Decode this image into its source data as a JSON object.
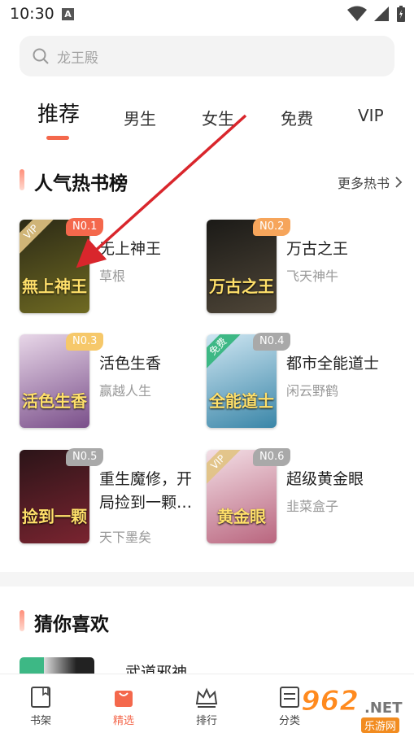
{
  "status_bar": {
    "time": "10:30",
    "notif_letter": "A"
  },
  "search": {
    "placeholder": "龙王殿"
  },
  "tabs": [
    {
      "label": "推荐",
      "active": true
    },
    {
      "label": "男生"
    },
    {
      "label": "女生"
    },
    {
      "label": "免费"
    },
    {
      "label": "VIP"
    }
  ],
  "hot_section": {
    "title": "人气热书榜",
    "more": "更多热书"
  },
  "books": [
    {
      "rank": "N0.1",
      "title": "无上神王",
      "author": "草根",
      "cover_text": "無上神王",
      "tag": "VIP",
      "rank_color": "#f4684c",
      "cover_colors": [
        "#2c2a16",
        "#6f6a22"
      ]
    },
    {
      "rank": "N0.2",
      "title": "万古之王",
      "author": "飞天神牛",
      "cover_text": "万古之王",
      "tag": "",
      "rank_color": "#f6a55b",
      "cover_colors": [
        "#1b1a17",
        "#4f4638"
      ]
    },
    {
      "rank": "N0.3",
      "title": "活色生香",
      "author": "赢越人生",
      "cover_text": "活色生香",
      "tag": "",
      "rank_color": "#f6c86a",
      "cover_colors": [
        "#e8d7e8",
        "#7a4f8a"
      ]
    },
    {
      "rank": "N0.4",
      "title": "都市全能道士",
      "author": "闲云野鹤",
      "cover_text": "全能道士",
      "tag": "免费",
      "rank_color": "#a9a9a9",
      "cover_colors": [
        "#cfe6f2",
        "#3a86a8"
      ]
    },
    {
      "rank": "N0.5",
      "title": "重生魔修，开局捡到一颗…",
      "author": "天下墨矣",
      "cover_text": "捡到一颗",
      "tag": "",
      "rank_color": "#a9a9a9",
      "cover_colors": [
        "#2b1418",
        "#7a2430"
      ]
    },
    {
      "rank": "N0.6",
      "title": "超级黄金眼",
      "author": "韭菜盒子",
      "cover_text": "黄金眼",
      "tag": "VIP",
      "rank_color": "#a9a9a9",
      "cover_colors": [
        "#f3dfe6",
        "#b9657e"
      ]
    }
  ],
  "guess_section": {
    "title": "猜你喜欢",
    "first_item_title": "武道邪神"
  },
  "bottom_nav": [
    {
      "label": "书架",
      "icon": "bookshelf-icon"
    },
    {
      "label": "精选",
      "icon": "featured-bag-icon",
      "active": true
    },
    {
      "label": "排行",
      "icon": "crown-icon"
    },
    {
      "label": "分类",
      "icon": "category-icon"
    }
  ],
  "watermark": {
    "num": "962",
    "net": ".NET",
    "sub": "乐游网"
  },
  "colors": {
    "accent": "#f4684c",
    "arrow": "#d9262c"
  }
}
